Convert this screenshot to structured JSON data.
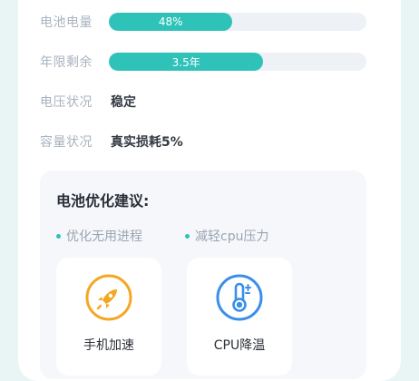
{
  "battery": {
    "level_label": "电池电量",
    "level_value": "48%",
    "level_fraction": 0.48,
    "lifespan_label": "年限剩余",
    "lifespan_value": "3.5年",
    "lifespan_fraction": 0.6,
    "voltage_label": "电压状况",
    "voltage_value": "稳定",
    "capacity_label": "容量状况",
    "capacity_value": "真实损耗5%"
  },
  "advice": {
    "title": "电池优化建议:",
    "tips": [
      "优化无用进程",
      "减轻cpu压力"
    ],
    "actions": [
      {
        "label": "手机加速",
        "icon": "rocket-icon"
      },
      {
        "label": "CPU降温",
        "icon": "thermometer-icon"
      }
    ]
  },
  "colors": {
    "accent": "#2ec2b8",
    "track": "#eef1f6",
    "rocket": "#f5a623",
    "thermo": "#3a8fe8"
  }
}
